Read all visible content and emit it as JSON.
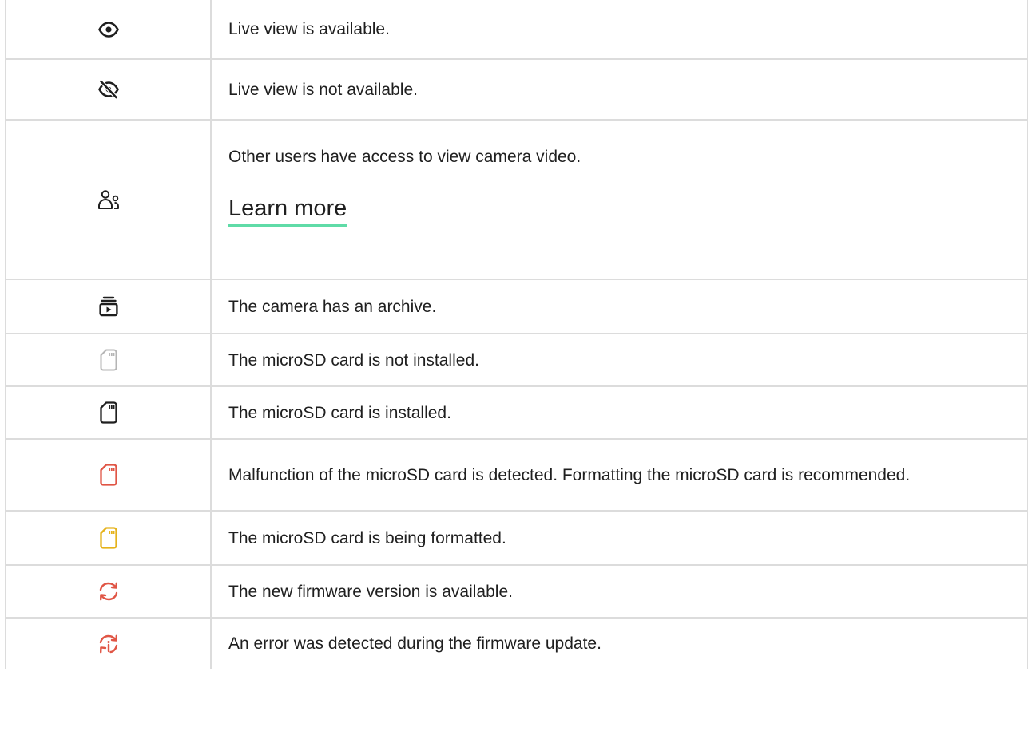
{
  "colors": {
    "icon_default": "#1f1f1f",
    "icon_muted": "#b5b5b5",
    "icon_error": "#e05545",
    "icon_warning": "#e5b21b",
    "link_underline": "#5fdba7",
    "border": "#dcdcdc"
  },
  "rows": [
    {
      "icon": "eye-icon",
      "text": "Live view is available."
    },
    {
      "icon": "eye-off-icon",
      "text": "Live view is not available."
    },
    {
      "icon": "users-icon",
      "text": "Other users have access to view camera video.",
      "link": "Learn more"
    },
    {
      "icon": "archive-play-icon",
      "text": "The camera has an archive."
    },
    {
      "icon": "microsd-card-icon",
      "state": "muted",
      "text": "The microSD card is not installed."
    },
    {
      "icon": "microsd-card-icon",
      "state": "default",
      "text": "The microSD card is installed."
    },
    {
      "icon": "microsd-card-icon",
      "state": "error",
      "text": "Malfunction of the microSD card is detected. Formatting the microSD card is recommended."
    },
    {
      "icon": "microsd-card-icon",
      "state": "warning",
      "text": "The microSD card is being formatted."
    },
    {
      "icon": "refresh-icon",
      "state": "error",
      "text": "The new firmware version is available."
    },
    {
      "icon": "refresh-info-icon",
      "state": "error",
      "text": "An error was detected during the firmware update."
    }
  ]
}
